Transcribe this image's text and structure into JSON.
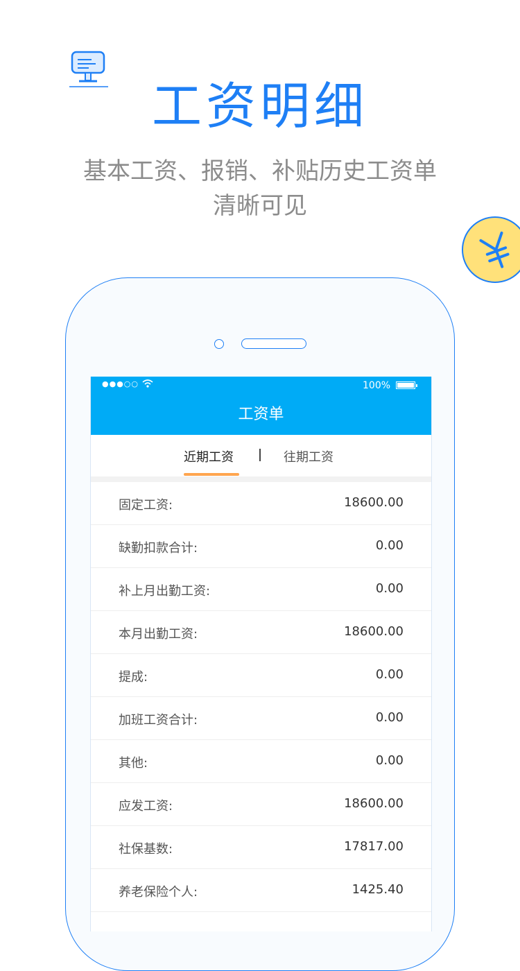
{
  "hero": {
    "title": "工资明细",
    "subtitle_line1": "基本工资、报销、补贴历史工资单",
    "subtitle_line2": "清晰可见"
  },
  "icons": {
    "monitor": "monitor-icon",
    "yen": "yen-icon",
    "wifi": "wifi-icon",
    "battery": "battery-icon"
  },
  "colors": {
    "accent": "#1e7ff5",
    "nav_bg": "#00abf6",
    "tab_underline": "#ffa54f",
    "badge_bg": "#ffe17a"
  },
  "status_bar": {
    "signal": "●●●○○",
    "battery": "100%"
  },
  "nav": {
    "title": "工资单"
  },
  "tabs": {
    "active": "近期工资",
    "inactive": "往期工资"
  },
  "rows": [
    {
      "label": "固定工资:",
      "value": "18600.00"
    },
    {
      "label": "缺勤扣款合计:",
      "value": "0.00"
    },
    {
      "label": "补上月出勤工资:",
      "value": "0.00"
    },
    {
      "label": "本月出勤工资:",
      "value": "18600.00"
    },
    {
      "label": "提成:",
      "value": "0.00"
    },
    {
      "label": "加班工资合计:",
      "value": "0.00"
    },
    {
      "label": "其他:",
      "value": "0.00"
    },
    {
      "label": "应发工资:",
      "value": "18600.00"
    },
    {
      "label": "社保基数:",
      "value": "17817.00"
    },
    {
      "label": "养老保险个人:",
      "value": "1425.40"
    }
  ]
}
